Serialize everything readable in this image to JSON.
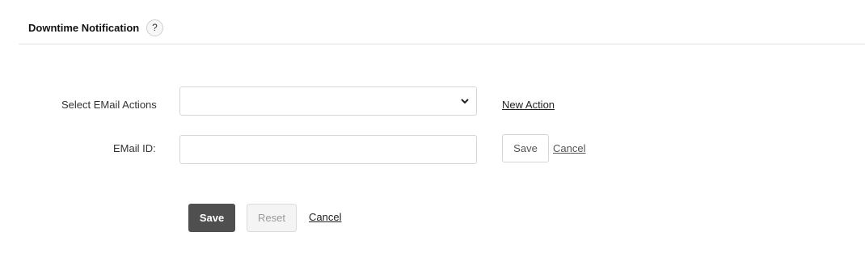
{
  "header": {
    "title": "Downtime Notification",
    "help_label": "?"
  },
  "form": {
    "select_label": "Select EMail Actions",
    "select_value": "",
    "new_action_link": "New Action",
    "email_label": "EMail ID:",
    "email_value": "",
    "email_save_label": "Save",
    "email_cancel_label": "Cancel"
  },
  "footer": {
    "save_label": "Save",
    "reset_label": "Reset",
    "cancel_label": "Cancel"
  }
}
